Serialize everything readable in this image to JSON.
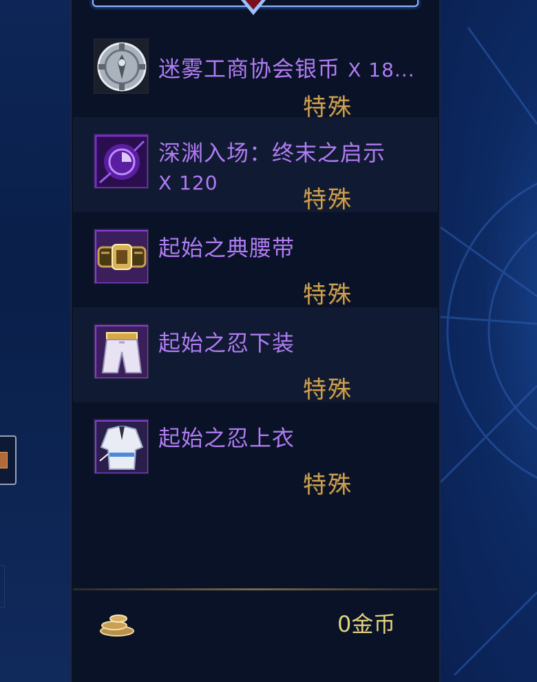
{
  "inventory": {
    "items": [
      {
        "name": "迷雾工商协会银币",
        "qty": "X 18...",
        "rarity": "特殊",
        "icon": "silver-coin-icon"
      },
      {
        "name": "深渊入场：终末之启示",
        "qty": "X 120",
        "rarity": "特殊",
        "icon": "abyss-ticket-icon"
      },
      {
        "name": "起始之典腰带",
        "qty": "",
        "rarity": "特殊",
        "icon": "belt-icon"
      },
      {
        "name": "起始之忍下装",
        "qty": "",
        "rarity": "特殊",
        "icon": "pants-icon"
      },
      {
        "name": "起始之忍上衣",
        "qty": "",
        "rarity": "特殊",
        "icon": "top-icon"
      }
    ]
  },
  "footer": {
    "gold": "0金币",
    "coin_icon": "gold-coins-icon"
  },
  "colors": {
    "item_name": "#b07cf2",
    "rarity": "#c9a055",
    "gold_text": "#e3d27a"
  }
}
